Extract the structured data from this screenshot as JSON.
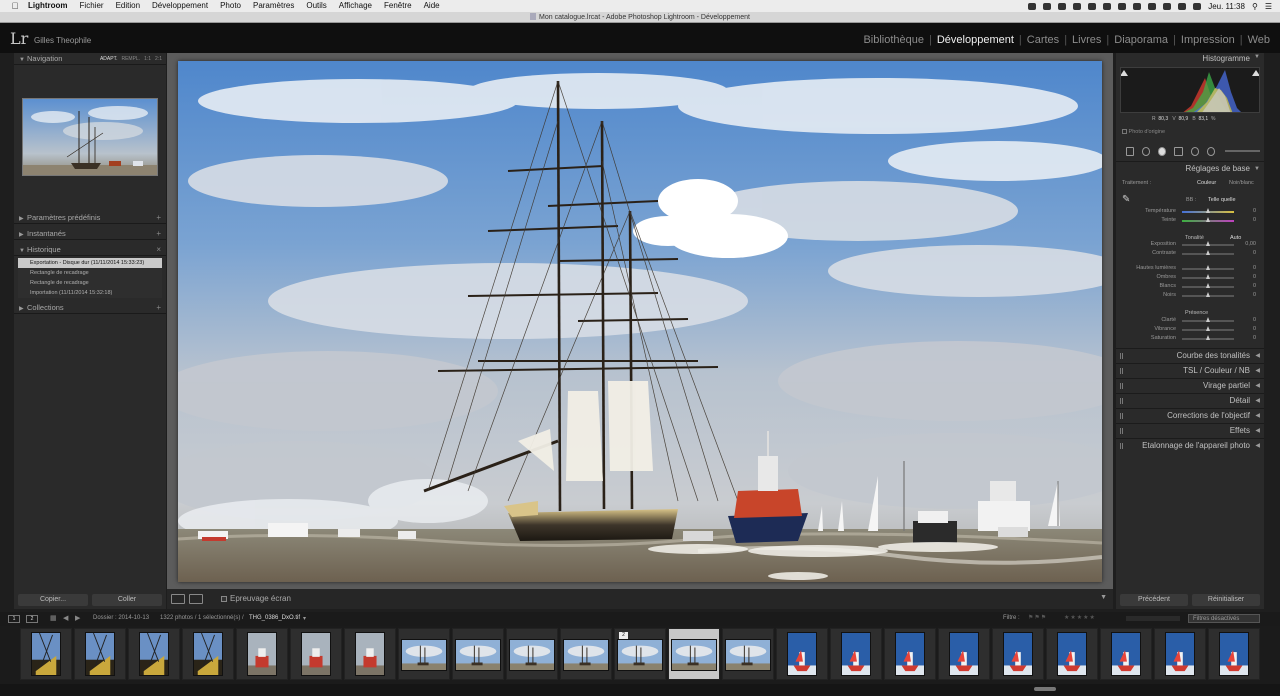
{
  "menubar": {
    "app": "Lightroom",
    "items": [
      "Fichier",
      "Edition",
      "Développement",
      "Photo",
      "Paramètres",
      "Outils",
      "Affichage",
      "Fenêtre",
      "Aide"
    ],
    "clock": "Jeu. 11:38"
  },
  "window": {
    "title": "Mon catalogue.lrcat - Adobe Photoshop Lightroom - Développement"
  },
  "identity": {
    "logo": "Lr",
    "user": "Gilles Theophile",
    "modules": [
      "Bibliothèque",
      "Développement",
      "Cartes",
      "Livres",
      "Diaporama",
      "Impression",
      "Web"
    ],
    "active_module": "Développement"
  },
  "left_panel": {
    "navigation": {
      "title": "Navigation",
      "options": [
        "ADAPT.",
        "REMPL.",
        "1:1",
        "2:1"
      ]
    },
    "presets": {
      "title": "Paramètres prédéfinis"
    },
    "snapshots": {
      "title": "Instantanés"
    },
    "history": {
      "title": "Historique",
      "items": [
        "Exportation - Disque dur (11/11/2014 15:33:23)",
        "Rectangle de recadrage",
        "Rectangle de recadrage",
        "Importation (11/11/2014 15:32:18)"
      ]
    },
    "collections": {
      "title": "Collections"
    },
    "copy_label": "Copier...",
    "paste_label": "Coller"
  },
  "toolbar": {
    "softproof_label": "Epreuvage écran"
  },
  "right_panel": {
    "histogram": {
      "title": "Histogramme",
      "r_label": "R",
      "r": "80,3",
      "v_label": "V",
      "v": "80,9",
      "b_label": "B",
      "b": "83,1",
      "unit": "%",
      "original_photo": "Photo d'origine"
    },
    "basic": {
      "title": "Réglages de base",
      "treatment_label": "Traitement :",
      "color": "Couleur",
      "bw": "Noir/blanc",
      "wb_label": "BB :",
      "wb_value": "Telle quelle",
      "tone_label": "Tonalité",
      "auto": "Auto",
      "presence_label": "Présence",
      "sliders": [
        {
          "label": "Température",
          "value": "0",
          "pos": 0.5,
          "style": "temp"
        },
        {
          "label": "Teinte",
          "value": "0",
          "pos": 0.5,
          "style": "tint"
        },
        {
          "label": "Exposition",
          "value": "0,00",
          "pos": 0.5,
          "style": ""
        },
        {
          "label": "Contraste",
          "value": "0",
          "pos": 0.5,
          "style": ""
        },
        {
          "label": "Hautes lumières",
          "value": "0",
          "pos": 0.5,
          "style": ""
        },
        {
          "label": "Ombres",
          "value": "0",
          "pos": 0.5,
          "style": ""
        },
        {
          "label": "Blancs",
          "value": "0",
          "pos": 0.5,
          "style": ""
        },
        {
          "label": "Noirs",
          "value": "0",
          "pos": 0.5,
          "style": ""
        },
        {
          "label": "Clarté",
          "value": "0",
          "pos": 0.5,
          "style": ""
        },
        {
          "label": "Vibrance",
          "value": "0",
          "pos": 0.5,
          "style": ""
        },
        {
          "label": "Saturation",
          "value": "0",
          "pos": 0.5,
          "style": ""
        }
      ]
    },
    "panels": [
      "Courbe des tonalités",
      "TSL / Couleur / NB",
      "Virage partiel",
      "Détail",
      "Corrections de l'objectif",
      "Effets",
      "Etalonnage de l'appareil photo"
    ],
    "prev_label": "Précédent",
    "reset_label": "Réinitialiser"
  },
  "filmstrip": {
    "page1": "1",
    "page2": "2",
    "folder": "Dossier : 2014-10-13",
    "count": "1322 photos / 1 sélectionné(s) /",
    "filename": "THG_0386_DxO.tif",
    "filter_label": "Filtre :",
    "filter_value": "Filtres désactivés",
    "selected_badge": "2",
    "thumbs": [
      "bow",
      "bow",
      "bow",
      "bow",
      "rescue",
      "rescue",
      "rescue",
      "fleet",
      "fleet",
      "fleet",
      "fleet",
      "fleet",
      "fleet",
      "fleet",
      "redboat",
      "redboat",
      "redboat",
      "redboat",
      "redboat",
      "redboat",
      "redboat",
      "redboat",
      "redboat"
    ],
    "selected_index": 12
  }
}
